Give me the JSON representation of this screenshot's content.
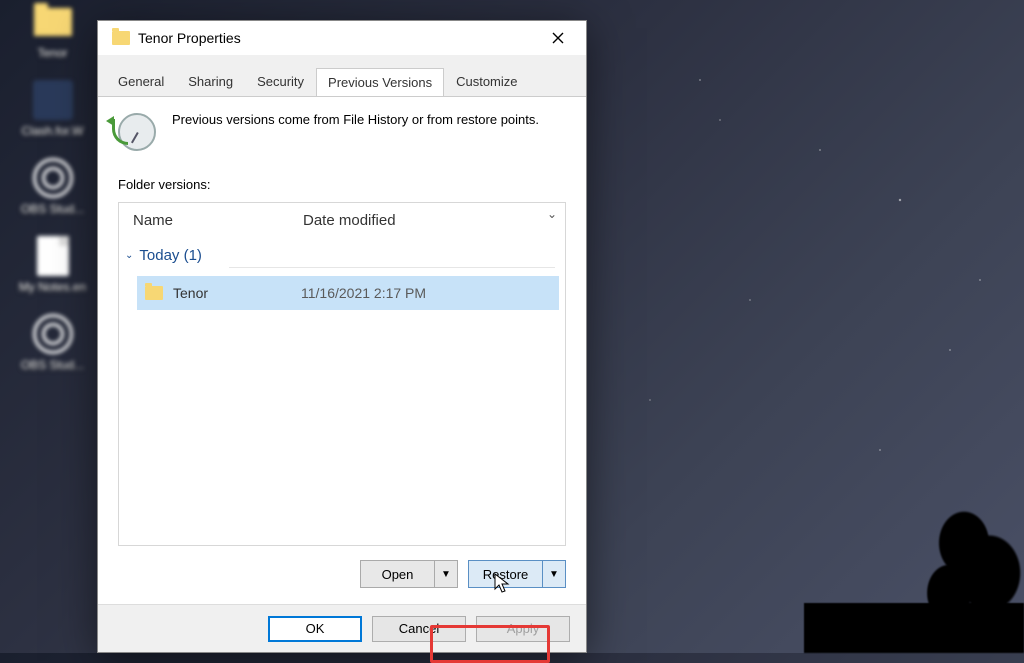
{
  "desktop": {
    "icons": [
      {
        "name": "tenor-folder",
        "label": "Tenor"
      },
      {
        "name": "clash-app",
        "label": "Clash.for.W"
      },
      {
        "name": "obs-studio-1",
        "label": "OBS Stud..."
      },
      {
        "name": "my-notes-doc",
        "label": "My Notes.en"
      },
      {
        "name": "obs-studio-2",
        "label": "OBS Stud..."
      }
    ]
  },
  "dialog": {
    "title": "Tenor Properties",
    "tabs": {
      "general": "General",
      "sharing": "Sharing",
      "security": "Security",
      "previous_versions": "Previous Versions",
      "customize": "Customize"
    },
    "hint": "Previous versions come from File History or from restore points.",
    "section_label": "Folder versions:",
    "columns": {
      "name": "Name",
      "date": "Date modified"
    },
    "group": {
      "label": "Today (1)"
    },
    "item": {
      "name": "Tenor",
      "date": "11/16/2021 2:17 PM"
    },
    "actions": {
      "open": "Open",
      "restore": "Restore"
    },
    "footer": {
      "ok": "OK",
      "cancel": "Cancel",
      "apply": "Apply"
    }
  }
}
